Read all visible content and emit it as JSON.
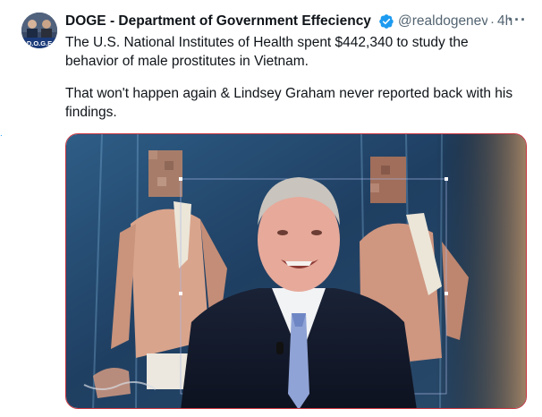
{
  "account": {
    "display_name": "DOGE - Department of Government Effeciency I",
    "handle": "@realdogenev",
    "separator": "·",
    "time": "4h",
    "avatar_text": "D.O.G.E",
    "verified_icon": "verified-badge-icon",
    "verified_color": "#1d9bf0"
  },
  "menu": {
    "more_label": "···"
  },
  "post": {
    "paragraph_1": "The U.S. National Institutes of Health spent $442,340 to study the behavior of male prostitutes in Vietnam.",
    "paragraph_2": "That won't happen again & Lindsey Graham never reported back with his findings."
  },
  "margin": {
    "mark": "."
  },
  "colors": {
    "text": "#0f1419",
    "secondary": "#536471",
    "accent": "#1d9bf0",
    "media_border": "#c8323c"
  }
}
